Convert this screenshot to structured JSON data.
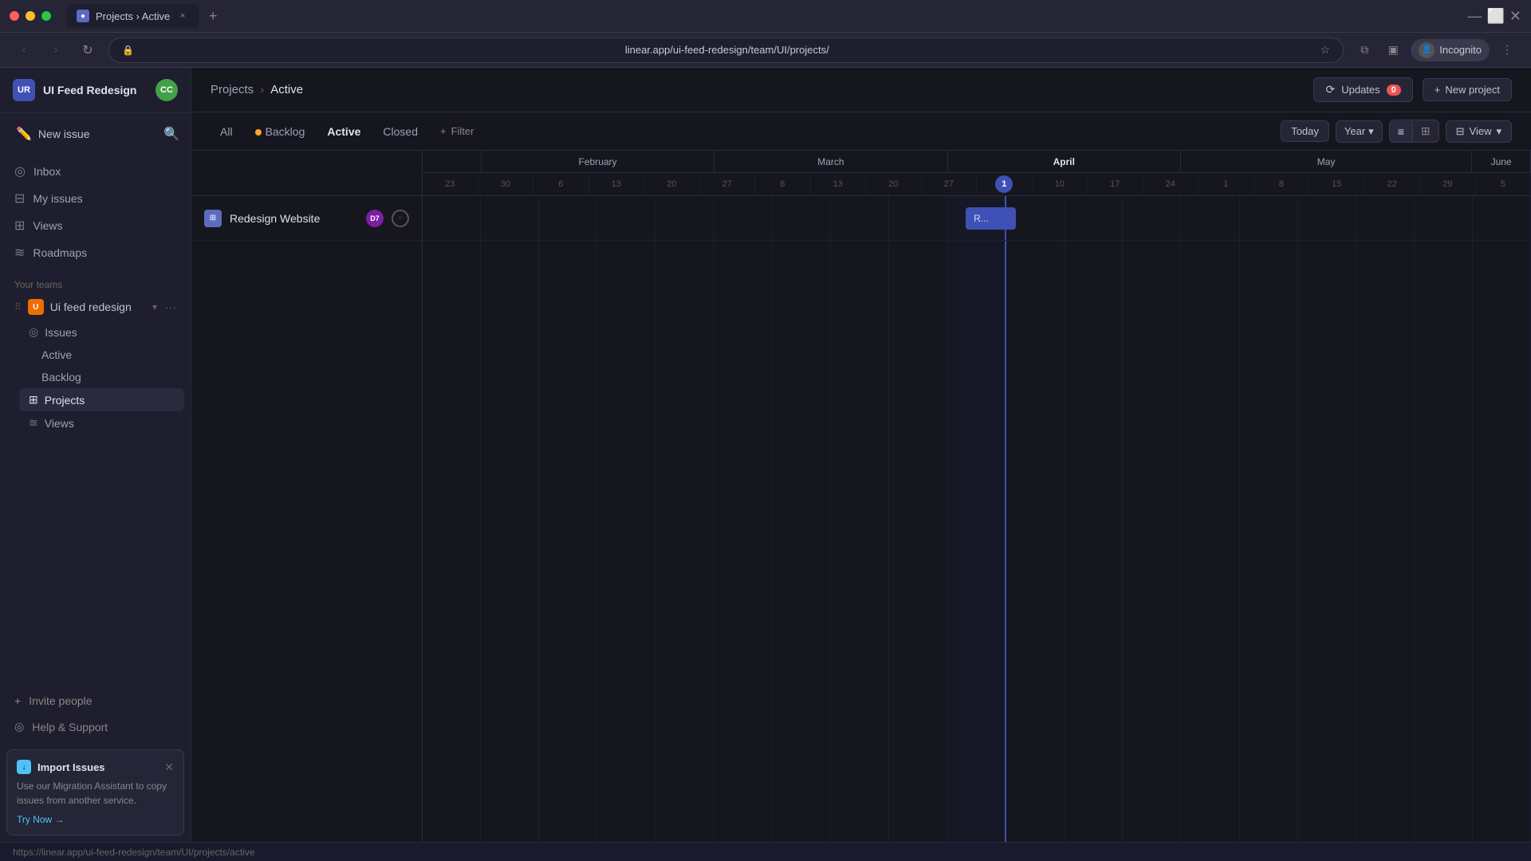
{
  "browser": {
    "tab_title": "Projects › Active",
    "tab_favicon": "P",
    "url": "linear.app/ui-feed-redesign/team/UI/projects/",
    "new_tab_label": "+",
    "nav": {
      "back": "‹",
      "forward": "›",
      "refresh": "↻"
    },
    "incognito_label": "Incognito",
    "extensions": {
      "bookmark": "☆",
      "puzzle": "⧉"
    }
  },
  "sidebar": {
    "workspace_initials": "UR",
    "workspace_name": "UI Feed Redesign",
    "user_initials": "CC",
    "new_issue_label": "New issue",
    "search_icon": "🔍",
    "nav_items": [
      {
        "id": "inbox",
        "label": "Inbox",
        "icon": "◎"
      },
      {
        "id": "my-issues",
        "label": "My issues",
        "icon": "⊟"
      },
      {
        "id": "views",
        "label": "Views",
        "icon": "⊞"
      },
      {
        "id": "roadmaps",
        "label": "Roadmaps",
        "icon": "≋"
      }
    ],
    "teams_section_label": "Your teams",
    "team": {
      "name": "Ui feed redesign",
      "initial": "U",
      "sub_items": [
        {
          "id": "issues",
          "label": "Issues",
          "children": [
            {
              "id": "active",
              "label": "Active"
            },
            {
              "id": "backlog",
              "label": "Backlog"
            }
          ]
        },
        {
          "id": "projects",
          "label": "Projects",
          "active": true
        },
        {
          "id": "views",
          "label": "Views"
        }
      ]
    },
    "invite_label": "Invite people",
    "help_label": "Help & Support",
    "import_card": {
      "title": "Import Issues",
      "description": "Use our Migration Assistant to copy issues from another service.",
      "cta_label": "Try Now →"
    }
  },
  "main": {
    "breadcrumb_parent": "Projects",
    "breadcrumb_sep": "›",
    "breadcrumb_current": "Active",
    "updates_label": "Updates",
    "updates_count": "0",
    "new_project_label": "New project",
    "filter_tabs": [
      {
        "id": "all",
        "label": "All"
      },
      {
        "id": "backlog",
        "label": "Backlog",
        "has_dot": true
      },
      {
        "id": "active",
        "label": "Active",
        "active": true
      },
      {
        "id": "closed",
        "label": "Closed"
      }
    ],
    "filter_label": "Filter",
    "today_label": "Today",
    "year_label": "Year",
    "view_label": "View",
    "months": [
      {
        "label": "",
        "weeks": [
          "23",
          "30"
        ]
      },
      {
        "label": "February",
        "weeks": [
          "6",
          "13",
          "20",
          "27"
        ]
      },
      {
        "label": "March",
        "weeks": [
          "6",
          "13",
          "20",
          "27"
        ]
      },
      {
        "label": "April",
        "weeks": [
          "1",
          "10",
          "17",
          "24"
        ]
      },
      {
        "label": "May",
        "weeks": [
          "1",
          "8",
          "15",
          "22",
          "29"
        ]
      },
      {
        "label": "June",
        "weeks": [
          "5"
        ]
      }
    ],
    "projects": [
      {
        "id": "redesign-website",
        "name": "Redesign Website",
        "avatar_initials": "D7",
        "bar_label": "R...",
        "bar_start_pct": 58,
        "bar_width_pct": 5
      }
    ]
  },
  "status_bar": {
    "url": "https://linear.app/ui-feed-redesign/team/UI/projects/active"
  }
}
